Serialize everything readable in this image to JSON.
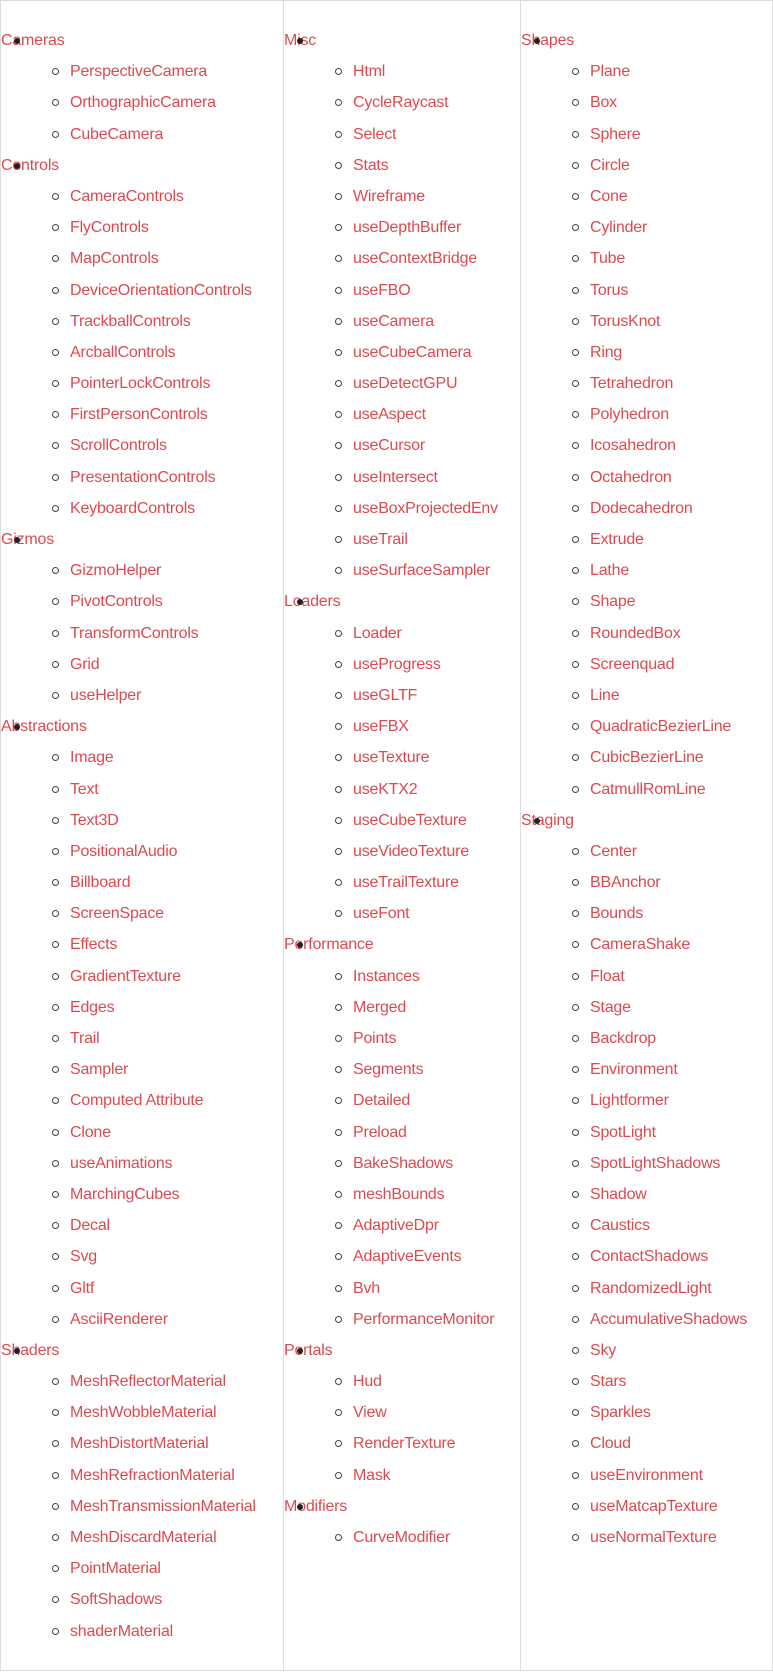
{
  "link_color": "#dc4a50",
  "columns": [
    [
      {
        "label": "Cameras",
        "items": [
          "PerspectiveCamera",
          "OrthographicCamera",
          "CubeCamera"
        ]
      },
      {
        "label": "Controls",
        "items": [
          "CameraControls",
          "FlyControls",
          "MapControls",
          "DeviceOrientationControls",
          "TrackballControls",
          "ArcballControls",
          "PointerLockControls",
          "FirstPersonControls",
          "ScrollControls",
          "PresentationControls",
          "KeyboardControls"
        ]
      },
      {
        "label": "Gizmos",
        "items": [
          "GizmoHelper",
          "PivotControls",
          "TransformControls",
          "Grid",
          "useHelper"
        ]
      },
      {
        "label": "Abstractions",
        "items": [
          "Image",
          "Text",
          "Text3D",
          "PositionalAudio",
          "Billboard",
          "ScreenSpace",
          "Effects",
          "GradientTexture",
          "Edges",
          "Trail",
          "Sampler",
          "Computed Attribute",
          "Clone",
          "useAnimations",
          "MarchingCubes",
          "Decal",
          "Svg",
          "Gltf",
          "AsciiRenderer"
        ]
      },
      {
        "label": "Shaders",
        "items": [
          "MeshReflectorMaterial",
          "MeshWobbleMaterial",
          "MeshDistortMaterial",
          "MeshRefractionMaterial",
          "MeshTransmissionMaterial",
          "MeshDiscardMaterial",
          "PointMaterial",
          "SoftShadows",
          "shaderMaterial"
        ]
      }
    ],
    [
      {
        "label": "Misc",
        "items": [
          "Html",
          "CycleRaycast",
          "Select",
          "Stats",
          "Wireframe",
          "useDepthBuffer",
          "useContextBridge",
          "useFBO",
          "useCamera",
          "useCubeCamera",
          "useDetectGPU",
          "useAspect",
          "useCursor",
          "useIntersect",
          "useBoxProjectedEnv",
          "useTrail",
          "useSurfaceSampler"
        ]
      },
      {
        "label": "Loaders",
        "items": [
          "Loader",
          "useProgress",
          "useGLTF",
          "useFBX",
          "useTexture",
          "useKTX2",
          "useCubeTexture",
          "useVideoTexture",
          "useTrailTexture",
          "useFont"
        ]
      },
      {
        "label": "Performance",
        "items": [
          "Instances",
          "Merged",
          "Points",
          "Segments",
          "Detailed",
          "Preload",
          "BakeShadows",
          "meshBounds",
          "AdaptiveDpr",
          "AdaptiveEvents",
          "Bvh",
          "PerformanceMonitor"
        ]
      },
      {
        "label": "Portals",
        "items": [
          "Hud",
          "View",
          "RenderTexture",
          "Mask"
        ]
      },
      {
        "label": "Modifiers",
        "items": [
          "CurveModifier"
        ]
      }
    ],
    [
      {
        "label": "Shapes",
        "items": [
          "Plane",
          "Box",
          "Sphere",
          "Circle",
          "Cone",
          "Cylinder",
          "Tube",
          "Torus",
          "TorusKnot",
          "Ring",
          "Tetrahedron",
          "Polyhedron",
          "Icosahedron",
          "Octahedron",
          "Dodecahedron",
          "Extrude",
          "Lathe",
          "Shape",
          "RoundedBox",
          "Screenquad",
          "Line",
          "QuadraticBezierLine",
          "CubicBezierLine",
          "CatmullRomLine"
        ]
      },
      {
        "label": "Staging",
        "items": [
          "Center",
          "BBAnchor",
          "Bounds",
          "CameraShake",
          "Float",
          "Stage",
          "Backdrop",
          "Environment",
          "Lightformer",
          "SpotLight",
          "SpotLightShadows",
          "Shadow",
          "Caustics",
          "ContactShadows",
          "RandomizedLight",
          "AccumulativeShadows",
          "Sky",
          "Stars",
          "Sparkles",
          "Cloud",
          "useEnvironment",
          "useMatcapTexture",
          "useNormalTexture"
        ]
      }
    ]
  ]
}
